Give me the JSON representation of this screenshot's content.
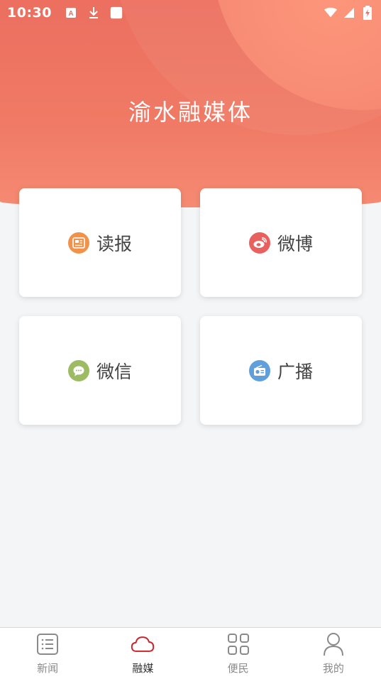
{
  "status_bar": {
    "time": "10:30",
    "icons": [
      "keyboard-a-icon",
      "download-icon",
      "square-icon",
      "wifi-icon",
      "signal-icon",
      "battery-icon"
    ]
  },
  "header": {
    "title": "渝水融媒体"
  },
  "cards": [
    {
      "label": "读报",
      "icon": "newspaper-icon",
      "color": "#f0924a"
    },
    {
      "label": "微博",
      "icon": "weibo-icon",
      "color": "#e8615e"
    },
    {
      "label": "微信",
      "icon": "wechat-icon",
      "color": "#9dbb63"
    },
    {
      "label": "广播",
      "icon": "radio-icon",
      "color": "#5f9fdb"
    }
  ],
  "tabbar": {
    "active_index": 1,
    "active_color": "#c8282d",
    "tabs": [
      {
        "label": "新闻",
        "icon": "list-icon"
      },
      {
        "label": "融媒",
        "icon": "cloud-icon"
      },
      {
        "label": "便民",
        "icon": "grid-icon"
      },
      {
        "label": "我的",
        "icon": "user-icon"
      }
    ]
  }
}
